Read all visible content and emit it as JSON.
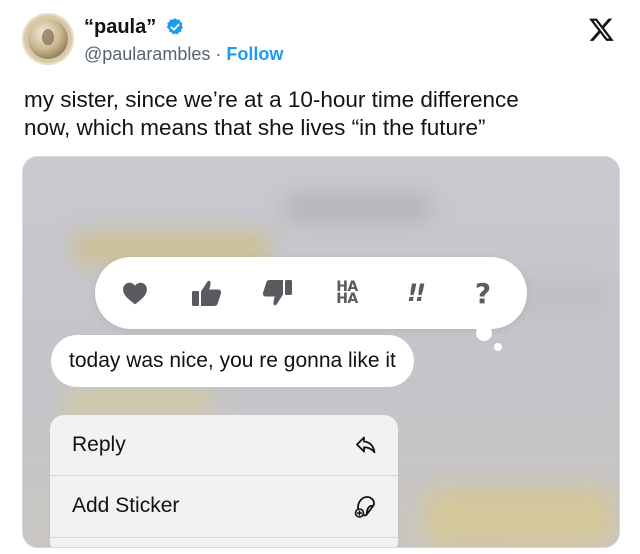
{
  "tweet": {
    "author": {
      "display_name": "“paula”",
      "handle": "@paularambles",
      "separator": "·",
      "follow_label": "Follow",
      "verified_color": "#1d9bf0"
    },
    "text_lines": [
      "my sister, since we’re at a 10-hour time difference",
      "now, which means that she lives “in the future”"
    ],
    "platform_icon": "x-logo-icon"
  },
  "screenshot": {
    "tapbacks": [
      {
        "name": "heart-icon"
      },
      {
        "name": "thumbs-up-icon"
      },
      {
        "name": "thumbs-down-icon"
      },
      {
        "name": "haha-icon",
        "label_top": "HA",
        "label_bottom": "HA"
      },
      {
        "name": "emphasis-icon",
        "label": "!!"
      },
      {
        "name": "question-icon",
        "label": "?"
      }
    ],
    "message": "today was nice, you re gonna like it",
    "context_menu": {
      "items": [
        {
          "label": "Reply",
          "icon": "reply-arrow-icon"
        },
        {
          "label": "Add Sticker",
          "icon": "sticker-icon"
        }
      ]
    }
  }
}
